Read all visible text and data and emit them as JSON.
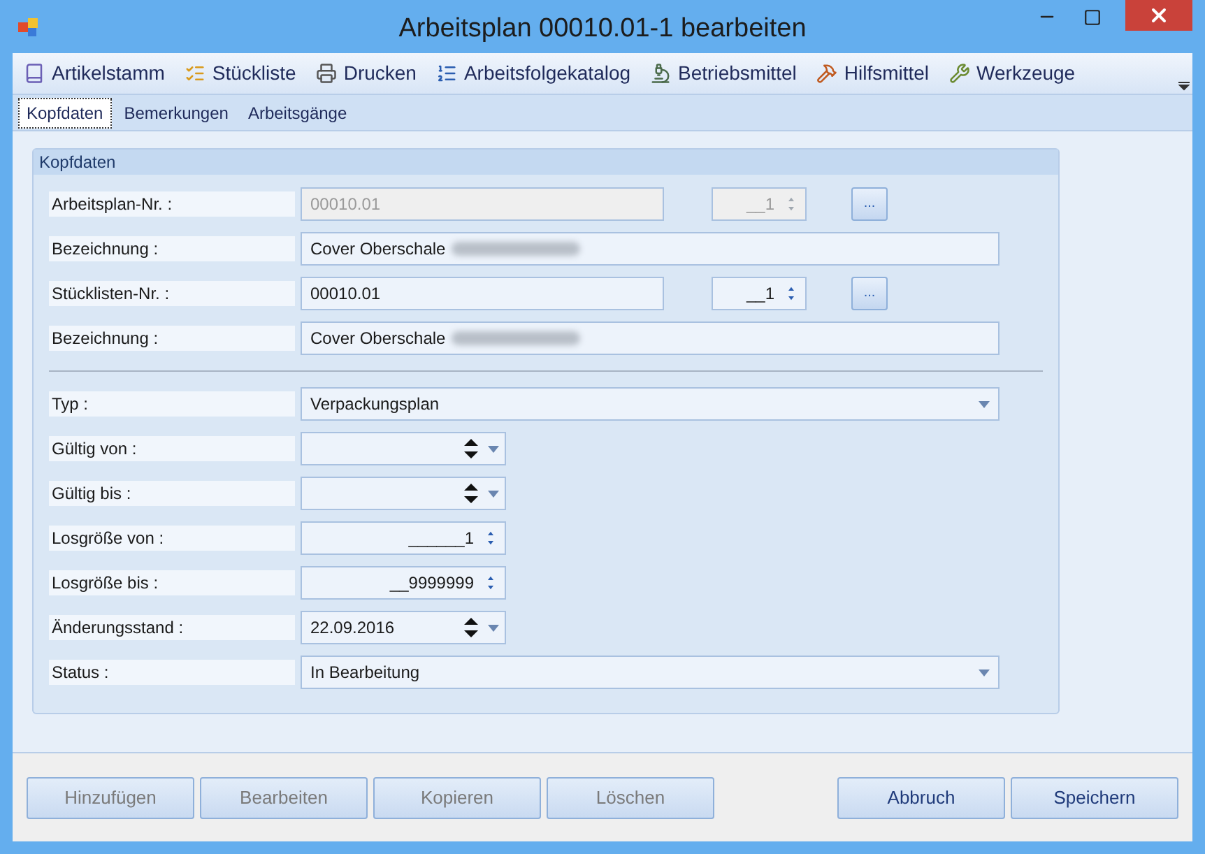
{
  "window": {
    "title": "Arbeitsplan 00010.01-1 bearbeiten"
  },
  "toolbar": [
    {
      "label": "Artikelstamm",
      "kind": "book"
    },
    {
      "label": "Stückliste",
      "kind": "list"
    },
    {
      "label": "Drucken",
      "kind": "printer"
    },
    {
      "label": "Arbeitsfolgekatalog",
      "kind": "catalog"
    },
    {
      "label": "Betriebsmittel",
      "kind": "machine"
    },
    {
      "label": "Hilfsmittel",
      "kind": "tool"
    },
    {
      "label": "Werkzeuge",
      "kind": "wrench"
    }
  ],
  "tabs": [
    {
      "label": "Kopfdaten",
      "selected": true
    },
    {
      "label": "Bemerkungen",
      "selected": false
    },
    {
      "label": "Arbeitsgänge",
      "selected": false
    }
  ],
  "panel": {
    "title": "Kopfdaten",
    "groups": [
      [
        {
          "label": "Arbeitsplan-Nr. :",
          "kind": "number",
          "value": "00010.01",
          "disabled": true,
          "spin": "__1",
          "button": "..."
        },
        {
          "label": "Bezeichnung :",
          "kind": "text",
          "value": "Cover Oberschale",
          "redacted": true,
          "disabled": false
        },
        {
          "label": "Stücklisten-Nr. :",
          "kind": "number",
          "value": "00010.01",
          "disabled": false,
          "spin": "__1",
          "button": "..."
        },
        {
          "label": "Bezeichnung :",
          "kind": "text",
          "value": "Cover Oberschale",
          "redacted": true,
          "disabled": false
        }
      ],
      [
        {
          "label": "Typ :",
          "kind": "combo",
          "value": "Verpackungsplan"
        },
        {
          "label": "Gültig von :",
          "kind": "date"
        },
        {
          "label": "Gültig bis :",
          "kind": "date"
        },
        {
          "label": "Losgröße von :",
          "kind": "spin",
          "value": "______1"
        },
        {
          "label": "Losgröße bis :",
          "kind": "spin",
          "value": "__9999999"
        },
        {
          "label": "Änderungsstand :",
          "kind": "date",
          "value": "22.09.2016"
        },
        {
          "label": "Status :",
          "kind": "combo",
          "value": "In Bearbeitung"
        }
      ]
    ]
  },
  "left_buttons": [
    {
      "label": "Hinzufügen",
      "disabled": true
    },
    {
      "label": "Bearbeiten",
      "disabled": true
    },
    {
      "label": "Kopieren",
      "disabled": true
    },
    {
      "label": "Löschen",
      "disabled": true
    }
  ],
  "right_buttons": [
    {
      "label": "Abbruch",
      "disabled": false
    },
    {
      "label": "Speichern",
      "disabled": false
    }
  ]
}
